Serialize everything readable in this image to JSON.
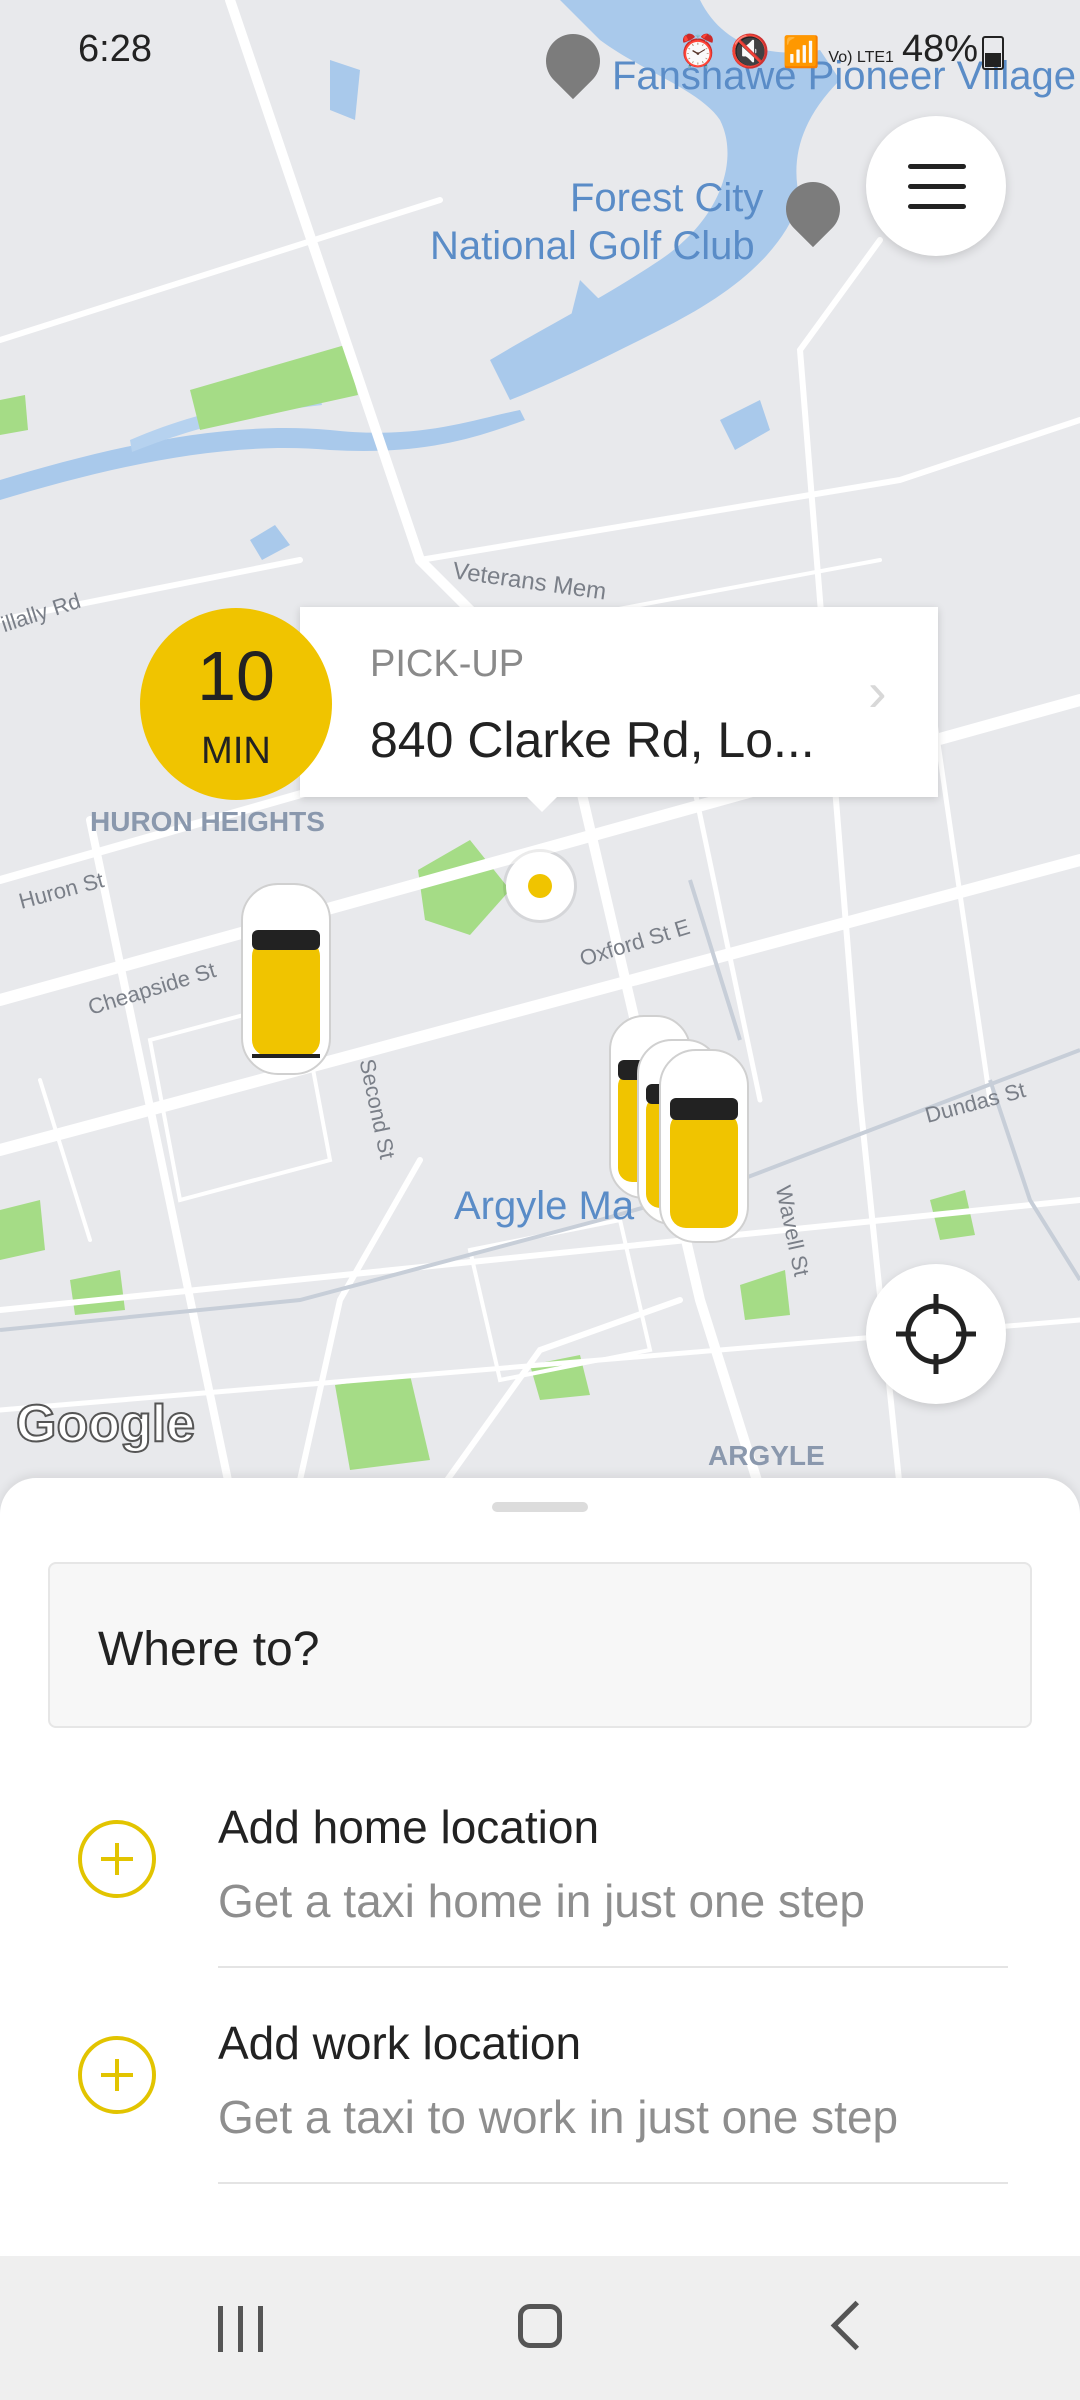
{
  "status_bar": {
    "time": "6:28",
    "battery": "48%",
    "network": "Vo) LTE1"
  },
  "map": {
    "labels": {
      "fanshawe": "Fanshawe Pioneer Village",
      "golf_line1": "Forest City",
      "golf_line2": "National Golf Club",
      "veterans": "Veterans Mem",
      "mcnally": "illally Rd",
      "huron_heights": "HURON HEIGHTS",
      "huron_st": "Huron St",
      "cheapside": "Cheapside St",
      "oxford": "Oxford St E",
      "second_st": "Second St",
      "dundas": "Dundas St",
      "argyle_mall": "Argyle Ma",
      "wavell": "Wavell St",
      "argyle": "ARGYLE",
      "google": "Google"
    },
    "icons": [
      "museum-pin-icon",
      "golf-pin-icon",
      "taxi-car-icon",
      "pickup-marker-icon"
    ]
  },
  "pickup": {
    "eta_value": "10",
    "eta_unit": "MIN",
    "label": "PICK-UP",
    "address": "840 Clarke Rd, Lo..."
  },
  "sheet": {
    "search_placeholder": "Where to?",
    "items": [
      {
        "title": "Add home location",
        "subtitle": "Get a taxi home in just one step"
      },
      {
        "title": "Add work location",
        "subtitle": "Get a taxi to work in just one step"
      }
    ]
  },
  "colors": {
    "accent": "#f0c400",
    "water": "#a9c9eb",
    "park": "#a5dc86",
    "map_bg": "#e8e9ec"
  }
}
